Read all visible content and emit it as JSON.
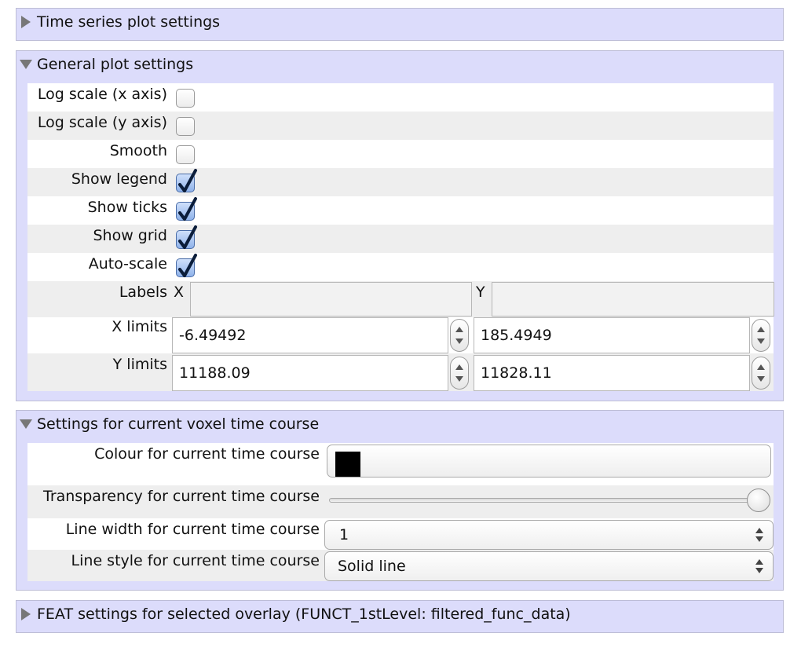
{
  "time_series_panel": {
    "title": "Time series plot settings",
    "expanded": false
  },
  "general_panel": {
    "title": "General plot settings",
    "expanded": true,
    "log_x": {
      "label": "Log scale (x axis)",
      "checked": false
    },
    "log_y": {
      "label": "Log scale (y axis)",
      "checked": false
    },
    "smooth": {
      "label": "Smooth",
      "checked": false
    },
    "show_legend": {
      "label": "Show legend",
      "checked": true
    },
    "show_ticks": {
      "label": "Show ticks",
      "checked": true
    },
    "show_grid": {
      "label": "Show grid",
      "checked": true
    },
    "auto_scale": {
      "label": "Auto-scale",
      "checked": true
    },
    "labels": {
      "label": "Labels",
      "x_tag": "X",
      "y_tag": "Y",
      "x_value": "",
      "y_value": ""
    },
    "x_limits": {
      "label": "X limits",
      "min": "-6.49492",
      "max": "185.4949"
    },
    "y_limits": {
      "label": "Y limits",
      "min": "11188.09",
      "max": "11828.11"
    }
  },
  "voxel_panel": {
    "title": "Settings for current voxel time course",
    "expanded": true,
    "colour": {
      "label": "Colour for current time course",
      "value": "#000000"
    },
    "transparency": {
      "label": "Transparency for current time course",
      "level": 1.0
    },
    "line_width": {
      "label": "Line width for current time course",
      "value": "1"
    },
    "line_style": {
      "label": "Line style for current time course",
      "value": "Solid line"
    }
  },
  "feat_panel": {
    "title": "FEAT settings for selected overlay (FUNCT_1stLevel: filtered_func_data)",
    "expanded": false
  },
  "colors": {
    "panel_bg": "#dcdcfb",
    "row_alt": "#eeeeee",
    "check_blue": "#8fb2ea"
  }
}
